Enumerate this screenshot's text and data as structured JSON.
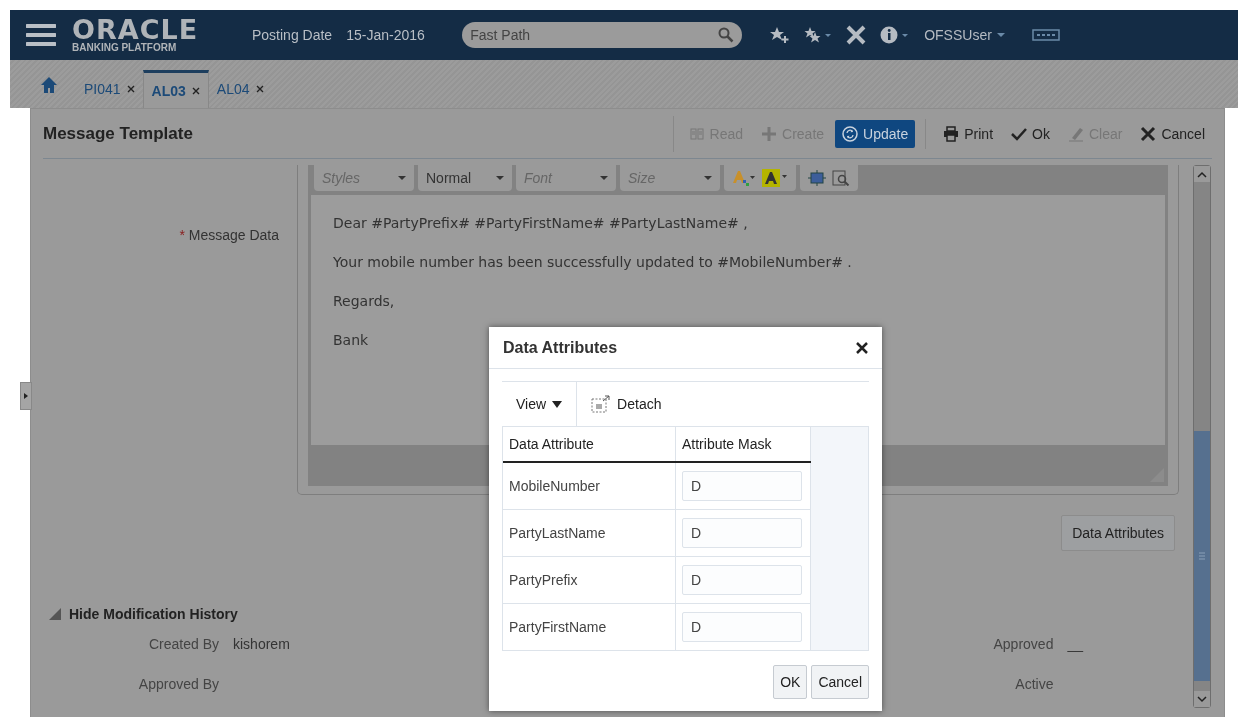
{
  "header": {
    "logo": "ORACLE",
    "logo_subtitle": "BANKING PLATFORM",
    "posting_date_label": "Posting Date",
    "posting_date": "15-Jan-2016",
    "fast_path": {
      "placeholder": "Fast Path"
    },
    "user": "OFSSUser"
  },
  "tabs": [
    {
      "label": "PI041",
      "selected": false
    },
    {
      "label": "AL03",
      "selected": true
    },
    {
      "label": "AL04",
      "selected": false
    }
  ],
  "page": {
    "title": "Message Template",
    "actions": [
      {
        "kind": "read",
        "label": "Read",
        "disabled": true,
        "selected": false
      },
      {
        "kind": "create",
        "label": "Create",
        "disabled": true,
        "selected": false
      },
      {
        "kind": "update",
        "label": "Update",
        "disabled": false,
        "selected": true
      },
      {
        "kind": "separator"
      },
      {
        "kind": "print",
        "label": "Print",
        "disabled": false,
        "selected": false
      },
      {
        "kind": "ok",
        "label": "Ok",
        "disabled": false,
        "selected": false
      },
      {
        "kind": "clear",
        "label": "Clear",
        "disabled": true,
        "selected": false
      },
      {
        "kind": "cancel",
        "label": "Cancel",
        "disabled": false,
        "selected": false
      }
    ]
  },
  "editor": {
    "label": "Message Data",
    "required_mark": "*",
    "dropdowns": [
      {
        "placeholder": "Styles"
      },
      {
        "value": "Normal"
      },
      {
        "placeholder": "Font"
      },
      {
        "placeholder": "Size"
      }
    ],
    "paragraphs": [
      "Dear #PartyPrefix# #PartyFirstName# #PartyLastName# ,",
      "Your mobile number has been successfully updated to #MobileNumber# .",
      "Regards,",
      "Bank"
    ]
  },
  "data_attributes_button": "Data Attributes",
  "history": {
    "toggle": "Hide Modification History",
    "expanded": true,
    "left_fields": [
      {
        "label": "Created By",
        "value": "kishorem"
      },
      {
        "label": "Approved By"
      }
    ],
    "right_fields": [
      {
        "label": "Approved",
        "value": "__"
      },
      {
        "label": "Active"
      }
    ]
  },
  "dialog": {
    "title": "Data Attributes",
    "view": "View",
    "detach": "Detach",
    "columns": [
      "Data Attribute",
      "Attribute Mask"
    ],
    "rows": [
      {
        "attribute": "MobileNumber",
        "mask": "D"
      },
      {
        "attribute": "PartyLastName",
        "mask": "D"
      },
      {
        "attribute": "PartyPrefix",
        "mask": "D"
      },
      {
        "attribute": "PartyFirstName",
        "mask": "D"
      }
    ],
    "buttons": [
      "OK",
      "Cancel"
    ]
  }
}
